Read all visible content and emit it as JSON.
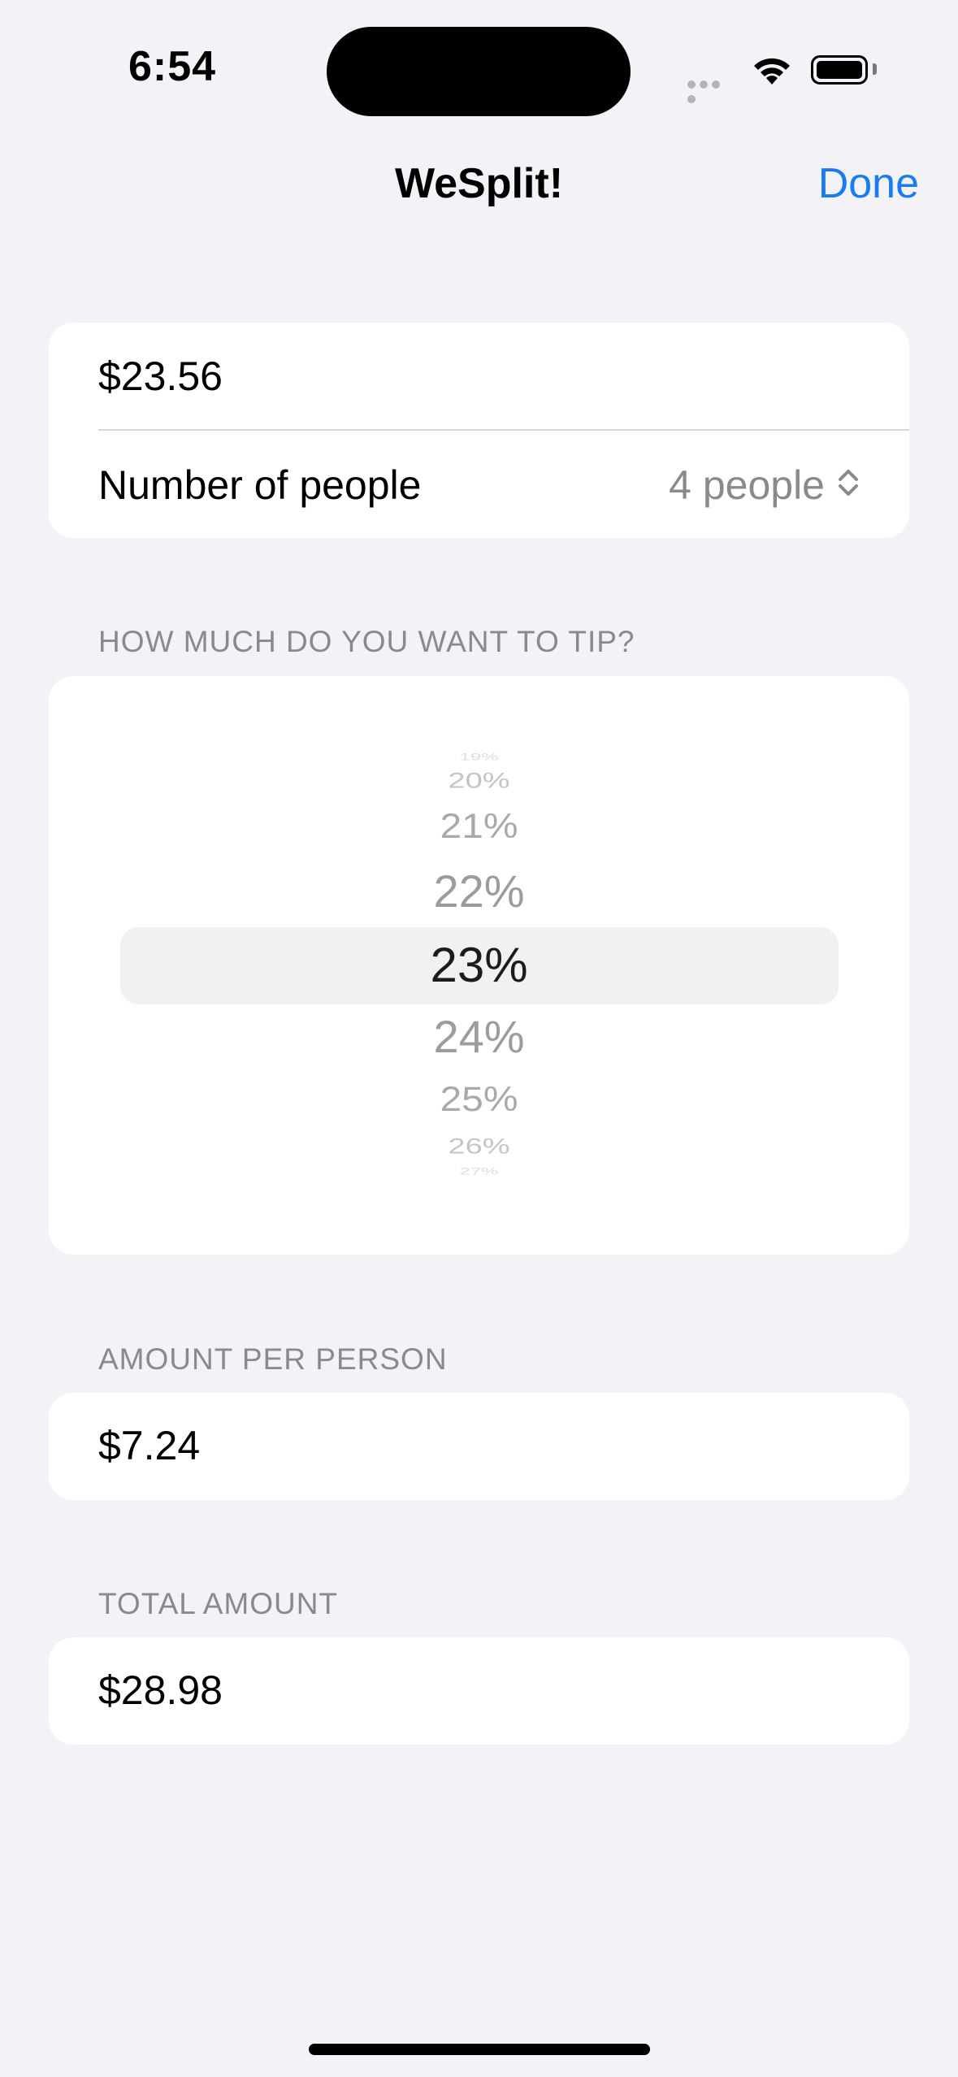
{
  "status_bar": {
    "time": "6:54"
  },
  "nav": {
    "title": "WeSplit!",
    "done_label": "Done"
  },
  "form": {
    "amount": "$23.56",
    "people_label": "Number of people",
    "people_value": "4 people"
  },
  "tip": {
    "header": "HOW MUCH DO YOU WANT TO TIP?",
    "options": [
      "19%",
      "20%",
      "21%",
      "22%",
      "23%",
      "24%",
      "25%",
      "26%",
      "27%"
    ],
    "selected": "23%"
  },
  "per_person": {
    "header": "AMOUNT PER PERSON",
    "value": "$7.24"
  },
  "total": {
    "header": "TOTAL AMOUNT",
    "value": "$28.98"
  },
  "colors": {
    "accent": "#1a7cf0",
    "background": "#f2f2f7",
    "secondary_text": "#8a8a8e"
  },
  "icons": [
    "wifi-icon",
    "battery-icon",
    "chevron-up-down-icon"
  ]
}
